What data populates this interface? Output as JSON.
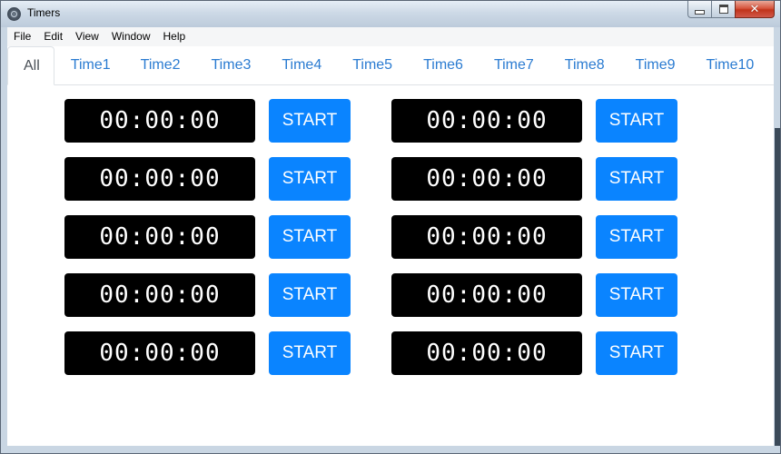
{
  "window": {
    "title": "Timers",
    "icon": "app-logo-icon"
  },
  "menu": [
    "File",
    "Edit",
    "View",
    "Window",
    "Help"
  ],
  "tabs": [
    {
      "label": "All",
      "active": true
    },
    {
      "label": "Time1"
    },
    {
      "label": "Time2"
    },
    {
      "label": "Time3"
    },
    {
      "label": "Time4"
    },
    {
      "label": "Time5"
    },
    {
      "label": "Time6"
    },
    {
      "label": "Time7"
    },
    {
      "label": "Time8"
    },
    {
      "label": "Time9"
    },
    {
      "label": "Time10"
    }
  ],
  "timers": [
    {
      "display": "00:00:00",
      "button": "START"
    },
    {
      "display": "00:00:00",
      "button": "START"
    },
    {
      "display": "00:00:00",
      "button": "START"
    },
    {
      "display": "00:00:00",
      "button": "START"
    },
    {
      "display": "00:00:00",
      "button": "START"
    },
    {
      "display": "00:00:00",
      "button": "START"
    },
    {
      "display": "00:00:00",
      "button": "START"
    },
    {
      "display": "00:00:00",
      "button": "START"
    },
    {
      "display": "00:00:00",
      "button": "START"
    },
    {
      "display": "00:00:00",
      "button": "START"
    }
  ],
  "colors": {
    "accent": "#0a84ff",
    "tab_link": "#2a7bd1",
    "timer_bg": "#000000"
  }
}
